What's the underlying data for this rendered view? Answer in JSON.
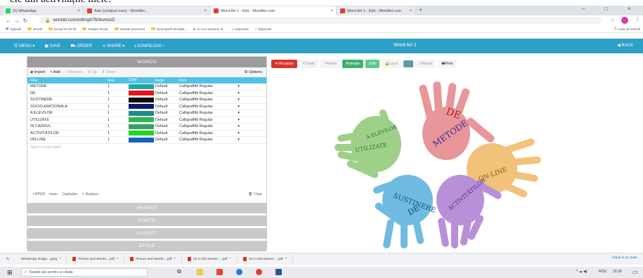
{
  "caption_top": "ele din activitățile mele.",
  "colors": {
    "accent": "#2e9fc6",
    "visualize": "#d9342b",
    "animate": "#3bb370",
    "table_header": "#4fc3e6"
  },
  "browser": {
    "tabs": [
      {
        "label": "(5) WhatsApp",
        "icon": "whatsapp-icon",
        "color": "#25d366"
      },
      {
        "label": "Arte (conținut meu) - WordArt...",
        "icon": "wordart-icon",
        "color": "#e03b3b"
      },
      {
        "label": "Word Art 1 - Edit - WordArt.com",
        "icon": "wordart-icon",
        "color": "#e03b3b",
        "active": true
      },
      {
        "label": "Word Art 1 - Edit - WordArt.com",
        "icon": "wordart-icon",
        "color": "#e03b3b"
      }
    ],
    "url": "wordart.com/edit/op07b0kumozD",
    "bookmarks": [
      "Aplicatii",
      "Emotii",
      "Emoții fel de fel",
      "Despre emoții",
      "Gazete perechea",
      "Descoperă emoțiile...",
      "cu ce-ti spunem el...",
      "Edpuzzle",
      "Edpuzzle"
    ],
    "reading_list": "Lista de lectură"
  },
  "app_nav": {
    "menu": "MENU",
    "save": "SAVE",
    "order": "ORDER",
    "share": "SHARE",
    "download": "DOWNLOAD",
    "title": "Word Art 1",
    "back": "BACK"
  },
  "words_panel": {
    "header": "WORDS",
    "toolbar": {
      "import": "Import",
      "add": "Add",
      "remove": "Remove",
      "up": "Up",
      "down": "Down",
      "options": "Options"
    },
    "columns": [
      "Filter",
      "Size",
      "Color",
      "Angle",
      "Font"
    ],
    "rows": [
      {
        "word": "METODE",
        "size": "1",
        "color": "#1ea8a0",
        "angle": "Default",
        "font": "Calligraffitti Regular"
      },
      {
        "word": "DE",
        "size": "1",
        "color": "#e8141d",
        "angle": "Default",
        "font": "Calligraffitti Regular"
      },
      {
        "word": "SUSTINERE",
        "size": "1",
        "color": "#111111",
        "angle": "Default",
        "font": "Calligraffitti Regular"
      },
      {
        "word": "SOCIO-EMIȚIONALĂ",
        "size": "1",
        "color": "#0c1a6e",
        "angle": "Default",
        "font": "Calligraffitti Regular"
      },
      {
        "word": "A ELEVILOR",
        "size": "1",
        "color": "#1e8c8a",
        "angle": "Default",
        "font": "Calligraffitti Regular"
      },
      {
        "word": "UTILIZATE",
        "size": "1",
        "color": "#2eb84e",
        "angle": "Default",
        "font": "Calligraffitti Regular"
      },
      {
        "word": "ÎN CADRUL",
        "size": "1",
        "color": "#3a9e6a",
        "angle": "Default",
        "font": "Calligraffitti Regular"
      },
      {
        "word": "ACTIVITĂȚILOR",
        "size": "1",
        "color": "#20d820",
        "angle": "Default",
        "font": "Calligraffitti Regular"
      },
      {
        "word": "ON-LINE",
        "size": "1",
        "color": "#1560c8",
        "angle": "Default",
        "font": "Calligraffitti Regular"
      }
    ],
    "new_word_placeholder": "Type in a new word",
    "case_buttons": {
      "upper": "UPPER",
      "lower": "lower",
      "capitalize": "Capitalize",
      "replace": "Replace",
      "clear": "Clear"
    }
  },
  "sections": [
    "SHAPES",
    "FONTS",
    "LAYOUT",
    "STYLE"
  ],
  "art_toolbar": {
    "visualize": "Visualize",
    "undo": "Undo",
    "redo": "Redo",
    "animate": "Animate",
    "edit": "Edit",
    "lock": "Lock",
    "reset": "Reset",
    "print": "Print"
  },
  "art_words": [
    "METODE",
    "DE",
    "SUSTINERE",
    "ON-LINE",
    "ACTIVITĂȚILOR",
    "UTILIZATE",
    "A ELEVILOR"
  ],
  "downloads": [
    {
      "name": "WhatsApp Image....jpeg",
      "type": "img"
    },
    {
      "name": "Picture and Words....pdf",
      "type": "pdf"
    },
    {
      "name": "Picture and Words....pdf",
      "type": "pdf"
    },
    {
      "name": "rst-1-125-stanne-....pdf",
      "type": "pdf"
    },
    {
      "name": "rst-1-125-stanne-....pdf",
      "type": "pdf"
    }
  ],
  "show_all": "Afișați le pe toate",
  "os": {
    "search_placeholder": "Tastați aici pentru a căuta",
    "lang": "ROU",
    "time": "23:29"
  }
}
